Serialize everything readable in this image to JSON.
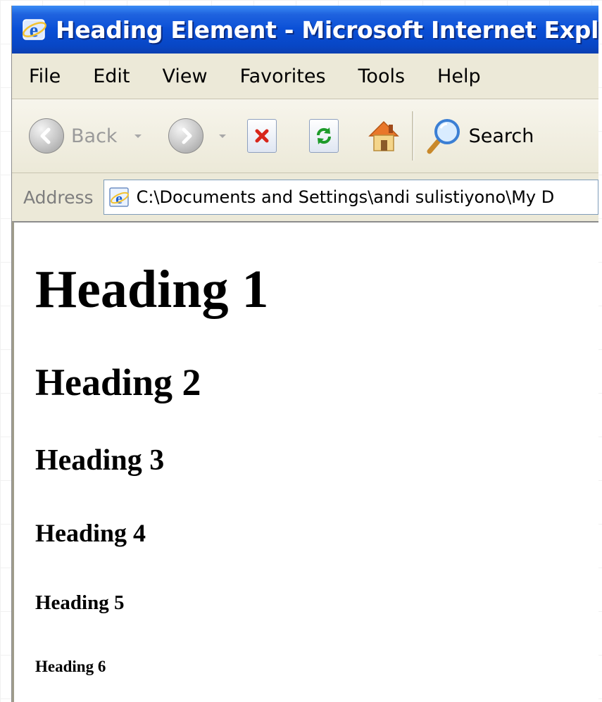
{
  "window": {
    "title": "Heading Element - Microsoft Internet Explorer"
  },
  "menu": [
    "File",
    "Edit",
    "View",
    "Favorites",
    "Tools",
    "Help"
  ],
  "toolbar": {
    "back_label": "Back",
    "search_label": "Search",
    "icons": [
      "back-icon",
      "forward-icon",
      "stop-icon",
      "refresh-icon",
      "home-icon",
      "search-icon"
    ]
  },
  "address": {
    "label": "Address",
    "value": "C:\\Documents and Settings\\andi sulistiyono\\My D"
  },
  "content": {
    "headings": [
      "Heading 1",
      "Heading 2",
      "Heading 3",
      "Heading 4",
      "Heading 5",
      "Heading 6"
    ]
  },
  "colors": {
    "titlebar": "#0a4fd6",
    "chrome": "#ece9d8",
    "page_bg": "#ffffff"
  }
}
